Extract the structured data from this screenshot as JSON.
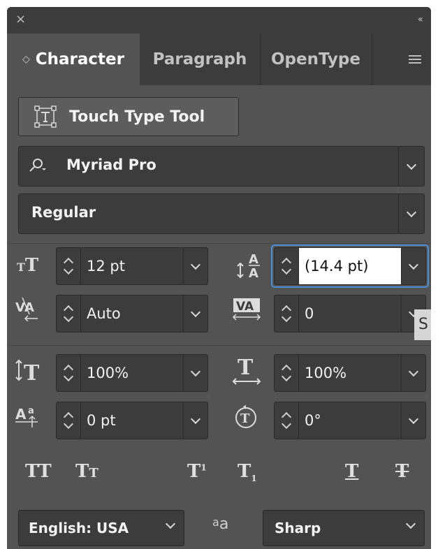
{
  "window": {
    "close_glyph": "×",
    "collapse_glyph": "‹‹"
  },
  "tabs": [
    {
      "label": "Character",
      "active": true
    },
    {
      "label": "Paragraph",
      "active": false
    },
    {
      "label": "OpenType",
      "active": false
    }
  ],
  "touch_type": {
    "label": "Touch Type Tool",
    "icon": "touch-type-icon"
  },
  "font_family": {
    "value": "Myriad Pro",
    "icon": "search-icon"
  },
  "font_style": {
    "value": "Regular"
  },
  "fields": {
    "font_size": {
      "value": "12 pt",
      "icon": "font-size-icon"
    },
    "leading": {
      "value": "(14.4 pt)",
      "icon": "leading-icon",
      "focused": true
    },
    "kerning": {
      "value": "Auto",
      "icon": "kerning-icon"
    },
    "tracking": {
      "value": "0",
      "icon": "tracking-icon"
    },
    "vertical_scale": {
      "value": "100%",
      "icon": "vertical-scale-icon"
    },
    "horizontal_scale": {
      "value": "100%",
      "icon": "horizontal-scale-icon"
    },
    "baseline_shift": {
      "value": "0 pt",
      "icon": "baseline-shift-icon"
    },
    "rotation": {
      "value": "0°",
      "icon": "character-rotation-icon"
    }
  },
  "tooltip_fragment": "S",
  "style_buttons": [
    {
      "glyph": "TT",
      "name": "all-caps"
    },
    {
      "glyph": "Tt",
      "name": "small-caps"
    },
    {
      "glyph": "T¹",
      "name": "superscript"
    },
    {
      "glyph": "T₁",
      "name": "subscript"
    },
    {
      "glyph": "T",
      "name": "underline"
    },
    {
      "glyph": "T",
      "name": "strikethrough"
    }
  ],
  "language": {
    "value": "English: USA"
  },
  "antialias": {
    "glyph": "ªa",
    "value": "Sharp"
  },
  "colors": {
    "panel_bg": "#535353",
    "header_bg": "#3c3c3c",
    "field_bg": "#3c3c3c",
    "focus_ring": "#4a90d9",
    "text": "#f2f2f2"
  }
}
